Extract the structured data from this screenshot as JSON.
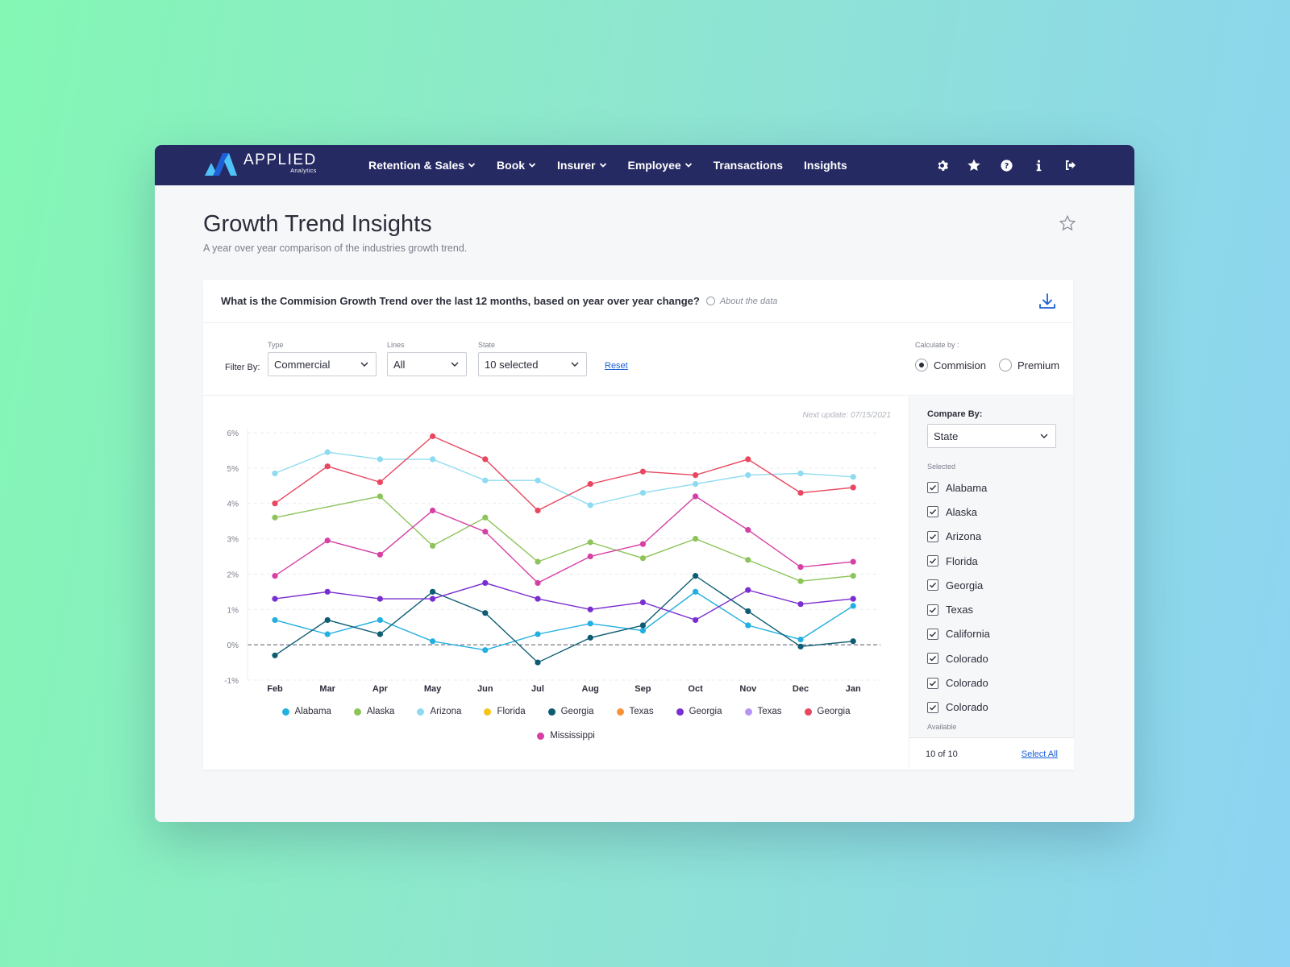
{
  "brand": {
    "name": "APPLIED",
    "sub": "Analytics"
  },
  "nav": {
    "items": [
      {
        "label": "Retention & Sales",
        "dropdown": true
      },
      {
        "label": "Book",
        "dropdown": true
      },
      {
        "label": "Insurer",
        "dropdown": true
      },
      {
        "label": "Employee",
        "dropdown": true
      },
      {
        "label": "Transactions",
        "dropdown": false
      },
      {
        "label": "Insights",
        "dropdown": false
      }
    ],
    "icons": [
      "gear-icon",
      "star-icon",
      "help-icon",
      "info-icon",
      "logout-icon"
    ]
  },
  "page": {
    "title": "Growth Trend Insights",
    "subtitle": "A year over year comparison of the industries growth trend."
  },
  "card": {
    "question": "What is the Commision Growth Trend over the last 12 months, based on year over year change?",
    "about": "About the data"
  },
  "filters": {
    "label": "Filter By:",
    "type": {
      "label": "Type",
      "value": "Commercial"
    },
    "lines": {
      "label": "Lines",
      "value": "All"
    },
    "state": {
      "label": "State",
      "value": "10 selected"
    },
    "reset": "Reset",
    "calculate": {
      "label": "Calculate by :",
      "options": [
        {
          "label": "Commision",
          "selected": true
        },
        {
          "label": "Premium",
          "selected": false
        }
      ]
    }
  },
  "next_update": "Next update:  07/15/2021",
  "compare": {
    "title": "Compare By:",
    "value": "State",
    "selected_label": "Selected",
    "items": [
      "Alabama",
      "Alaska",
      "Arizona",
      "Florida",
      "Georgia",
      "Texas",
      "California",
      "Colorado",
      "Colorado",
      "Colorado"
    ],
    "available_label": "Available",
    "count": "10 of 10",
    "select_all": "Select All"
  },
  "colors": {
    "nav_bg": "#262a63",
    "link": "#1c5fd6",
    "logo_dark": "#1c5fd6",
    "logo_light": "#4fc3f7"
  },
  "chart_data": {
    "type": "line",
    "categories": [
      "Feb",
      "Mar",
      "Apr",
      "May",
      "Jun",
      "Jul",
      "Aug",
      "Sep",
      "Oct",
      "Nov",
      "Dec",
      "Jan"
    ],
    "y_ticks": [
      "6%",
      "5%",
      "4%",
      "3%",
      "2%",
      "1%",
      "0%",
      "-1%"
    ],
    "ylim": [
      -1,
      6
    ],
    "grid": true,
    "zero_line": "dashed",
    "series": [
      {
        "name": "Alabama",
        "color": "#22b0e0",
        "values": [
          0.7,
          0.3,
          0.7,
          0.1,
          -0.15,
          0.3,
          0.6,
          0.4,
          1.5,
          0.55,
          0.15,
          1.1
        ]
      },
      {
        "name": "Alaska",
        "color": "#8dc45a",
        "values": [
          3.6,
          null,
          4.2,
          2.8,
          3.6,
          2.35,
          2.9,
          2.45,
          3.0,
          2.4,
          1.8,
          1.95
        ]
      },
      {
        "name": "Arizona",
        "color": "#8edbf0",
        "values": [
          4.85,
          5.45,
          5.25,
          5.25,
          4.65,
          4.65,
          3.95,
          4.3,
          4.55,
          4.8,
          4.85,
          4.75
        ]
      },
      {
        "name": "Florida",
        "color": "#f5c518",
        "values": []
      },
      {
        "name": "Georgia",
        "color": "#0d5c73",
        "values": [
          -0.3,
          0.7,
          0.3,
          1.5,
          0.9,
          -0.5,
          0.2,
          0.55,
          1.95,
          0.95,
          -0.05,
          0.1
        ]
      },
      {
        "name": "Texas",
        "color": "#f5923a",
        "values": []
      },
      {
        "name": "Georgia",
        "color": "#7a2ecf",
        "values": [
          1.3,
          1.5,
          1.3,
          1.3,
          1.75,
          1.3,
          1.0,
          1.2,
          0.7,
          1.55,
          1.15,
          1.3
        ]
      },
      {
        "name": "Texas",
        "color": "#b794f4",
        "values": []
      },
      {
        "name": "Georgia",
        "color": "#e8475f",
        "values": [
          4.0,
          5.05,
          4.6,
          5.9,
          5.25,
          3.8,
          4.55,
          4.9,
          4.8,
          5.25,
          4.3,
          4.45
        ]
      },
      {
        "name": "Mississippi",
        "color": "#d63fa4",
        "values": [
          1.95,
          2.95,
          2.55,
          3.8,
          3.2,
          1.75,
          2.5,
          2.85,
          4.2,
          3.25,
          2.2,
          2.35
        ]
      }
    ]
  }
}
